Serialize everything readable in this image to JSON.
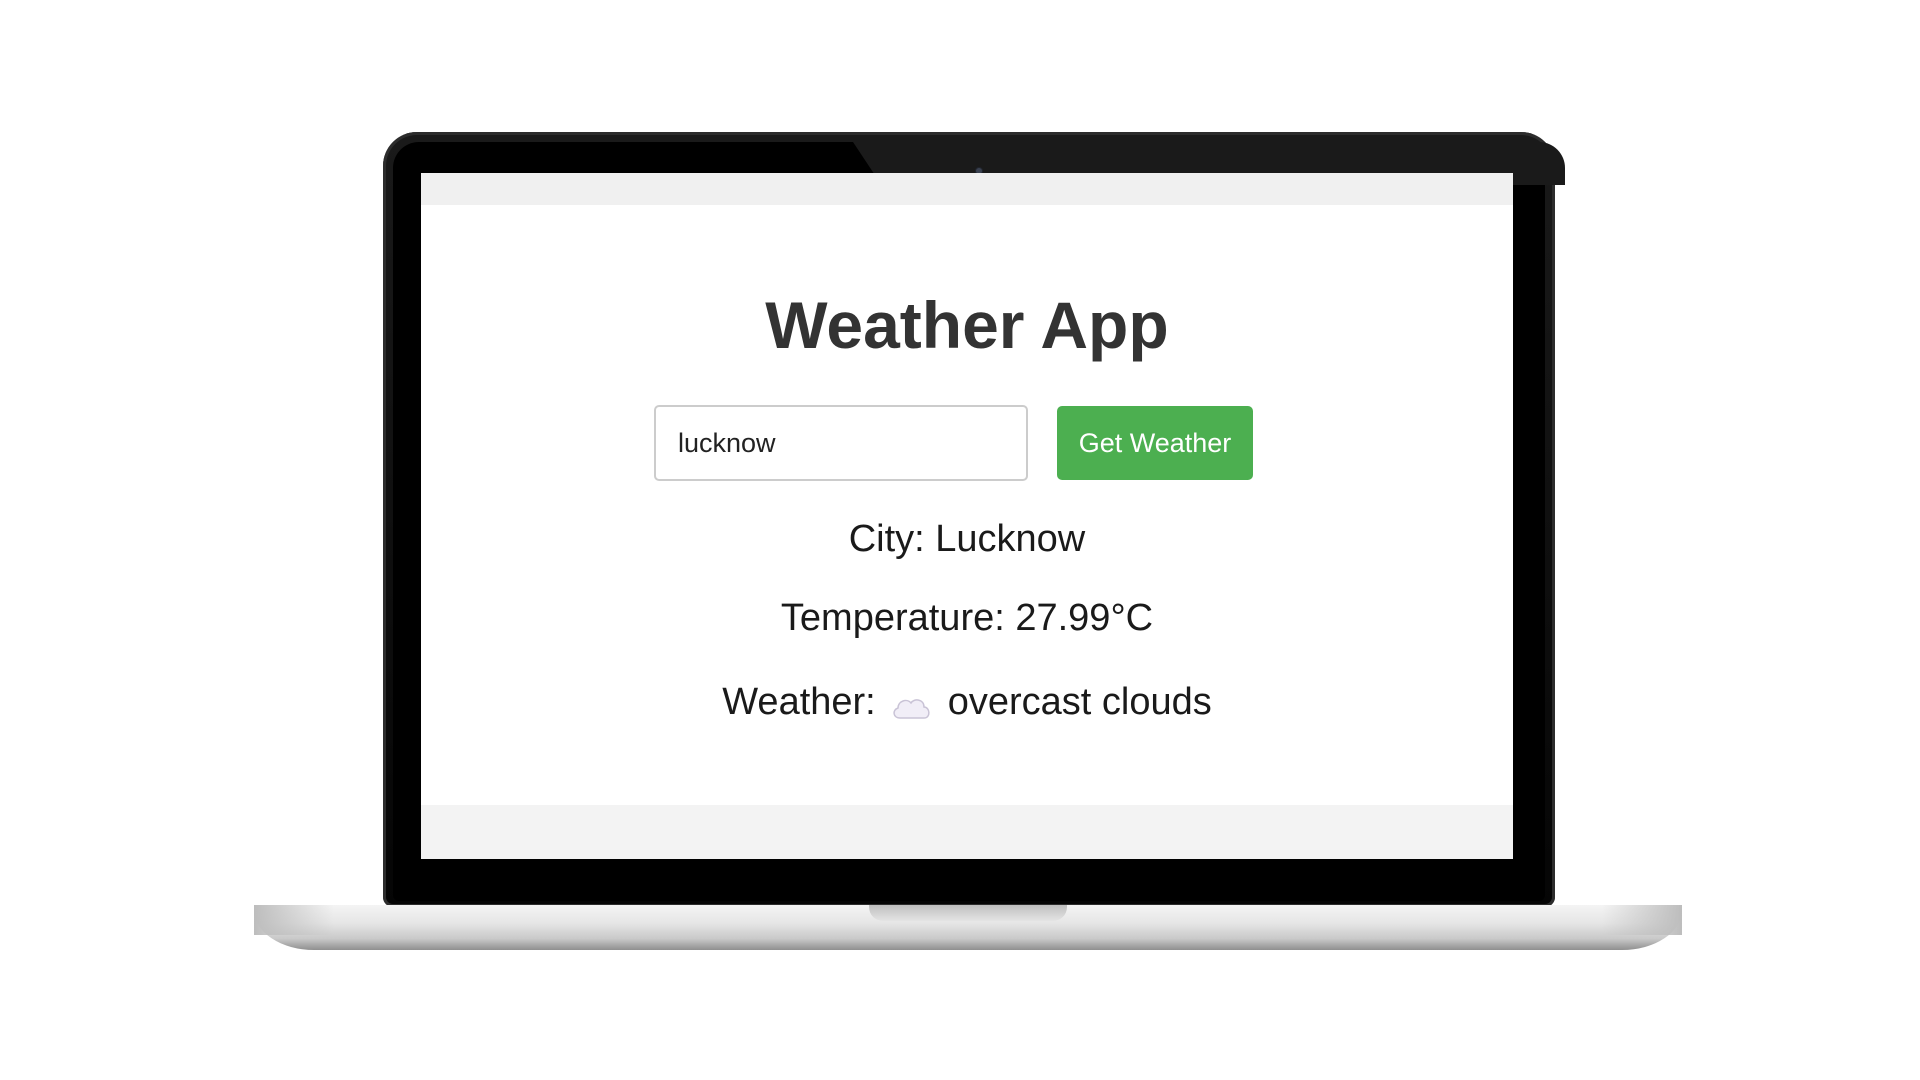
{
  "app": {
    "title": "Weather App"
  },
  "search": {
    "value": "lucknow",
    "button_label": "Get Weather"
  },
  "result": {
    "city_line": "City: Lucknow",
    "temperature_line": "Temperature: 27.99°C",
    "weather_label": "Weather:",
    "weather_desc": "overcast clouds",
    "weather_icon": "cloud-icon"
  },
  "colors": {
    "button_bg": "#4caf50",
    "title_text": "#333333"
  }
}
